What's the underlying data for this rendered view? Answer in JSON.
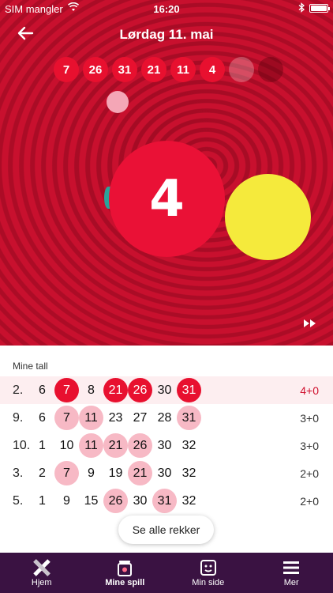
{
  "status": {
    "carrier": "SIM mangler",
    "time": "16:20"
  },
  "header": {
    "title": "Lørdag 11. mai"
  },
  "drawn_numbers": [
    "7",
    "26",
    "31",
    "21",
    "11",
    "4"
  ],
  "current_ball": "4",
  "colors": {
    "accent": "#e8102f",
    "hero_bg": "#c8102e",
    "nav_bg": "#3a1242",
    "yellow": "#f5ea3c"
  },
  "list": {
    "label": "Mine tall",
    "rows": [
      {
        "idx": "2.",
        "nums": [
          "6",
          "7",
          "8",
          "21",
          "26",
          "30",
          "31"
        ],
        "score": "4+0"
      },
      {
        "idx": "9.",
        "nums": [
          "6",
          "7",
          "11",
          "23",
          "27",
          "28",
          "31"
        ],
        "score": "3+0"
      },
      {
        "idx": "10.",
        "nums": [
          "1",
          "10",
          "11",
          "21",
          "26",
          "30",
          "32"
        ],
        "score": "3+0"
      },
      {
        "idx": "3.",
        "nums": [
          "2",
          "7",
          "9",
          "19",
          "21",
          "30",
          "32"
        ],
        "score": "2+0"
      },
      {
        "idx": "5.",
        "nums": [
          "1",
          "9",
          "15",
          "26",
          "30",
          "31",
          "32"
        ],
        "score": "2+0"
      }
    ],
    "see_all": "Se alle rekker"
  },
  "nav": {
    "items": [
      {
        "label": "Hjem",
        "icon": "hjem-icon"
      },
      {
        "label": "Mine spill",
        "icon": "mine-spill-icon"
      },
      {
        "label": "Min side",
        "icon": "min-side-icon"
      },
      {
        "label": "Mer",
        "icon": "menu-icon"
      }
    ]
  }
}
